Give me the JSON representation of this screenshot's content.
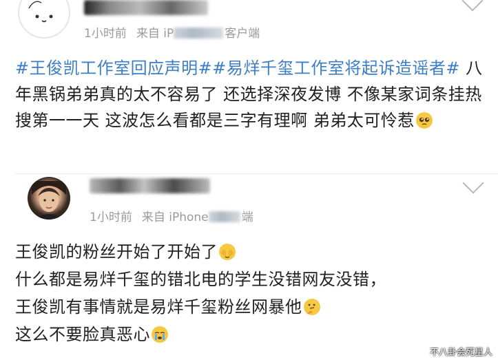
{
  "post1": {
    "username_blurred": true,
    "meta": {
      "time": "1小时前",
      "source_prefix": "来自 iP",
      "source_suffix": "客户端"
    },
    "content": {
      "topic1": "#王俊凯工作室回应声明#",
      "topic2": "#易烊千玺工作室将起诉造谣者#",
      "text": " 八年黑锅弟弟真的太不容易了 还选择深夜发博 不像某家词条挂热搜第一一天 这波怎么看都是三字有理啊 弟弟太可怜惹",
      "emoji": "pleading-face"
    }
  },
  "post2": {
    "username_blurred": true,
    "meta": {
      "time": "1小时前",
      "source_prefix": "来自 iPhone",
      "source_suffix": "端"
    },
    "content": {
      "line1": "王俊凯的粉丝开始了开始了",
      "line1_emoji": "face-with-hand-over-eyes",
      "line2": "什么都是易烊千玺的错北电的学生没错网友没错，",
      "line3": "王俊凯有事情就是易烊千玺粉丝网暴他",
      "line3_emoji": "thinking-face",
      "line4": "这么不要脸真恶心",
      "line4_emoji": "crying-face"
    }
  },
  "watermark": "不八卦会死星人",
  "colors": {
    "topic": "#3b7ec6",
    "meta": "#9a9a9a",
    "text": "#1f1f1f"
  }
}
